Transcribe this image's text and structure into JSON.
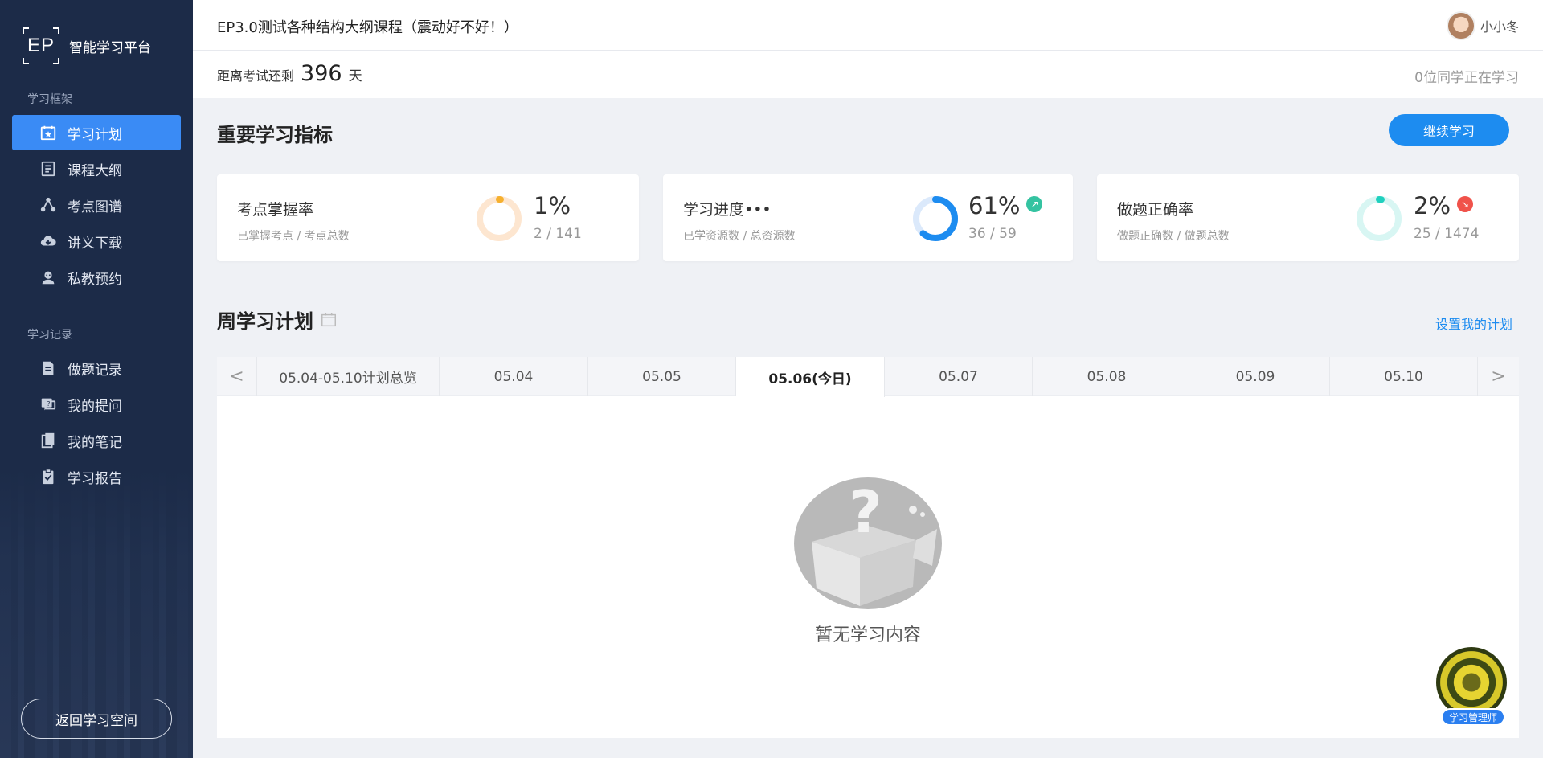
{
  "app": {
    "logo_text": "EP",
    "name": "智能学习平台"
  },
  "sidebar": {
    "section1": "学习框架",
    "items1": [
      {
        "label": "学习计划",
        "icon": "calendar-star-icon",
        "active": true
      },
      {
        "label": "课程大纲",
        "icon": "outline-icon"
      },
      {
        "label": "考点图谱",
        "icon": "graph-icon"
      },
      {
        "label": "讲义下载",
        "icon": "cloud-download-icon"
      },
      {
        "label": "私教预约",
        "icon": "tutor-icon"
      }
    ],
    "section2": "学习记录",
    "items2": [
      {
        "label": "做题记录",
        "icon": "document-icon"
      },
      {
        "label": "我的提问",
        "icon": "question-icon"
      },
      {
        "label": "我的笔记",
        "icon": "notes-icon"
      },
      {
        "label": "学习报告",
        "icon": "clipboard-icon"
      }
    ],
    "back_button": "返回学习空间"
  },
  "header": {
    "course_title": "EP3.0测试各种结构大纲课程（震动好不好！）",
    "username": "小小冬",
    "countdown_prefix": "距离考试还剩",
    "countdown_days": "396",
    "countdown_unit": "天",
    "studying_now": "0位同学正在学习"
  },
  "metrics": {
    "title": "重要学习指标",
    "continue_button": "继续学习",
    "cards": [
      {
        "label": "考点掌握率",
        "sub": "已掌握考点 / 考点总数",
        "pct": "1%",
        "ratio": "2 / 141",
        "value": 0.01,
        "color": "#f6b02e",
        "track": "#fde6d0"
      },
      {
        "label": "学习进度•••",
        "sub": "已学资源数 / 总资源数",
        "pct": "61%",
        "ratio": "36 / 59",
        "value": 0.61,
        "color": "#1d8cf0",
        "track": "#dbe9fb",
        "trend": "up",
        "trend_color": "#34c3a1"
      },
      {
        "label": "做题正确率",
        "sub": "做题正确数 / 做题总数",
        "pct": "2%",
        "ratio": "25 / 1474",
        "value": 0.02,
        "color": "#1fd0be",
        "track": "#d8f6f3",
        "trend": "down",
        "trend_color": "#f0524a"
      }
    ]
  },
  "weekly": {
    "title": "周学习计划",
    "set_plan_link": "设置我的计划",
    "tabs": [
      "05.04-05.10计划总览",
      "05.04",
      "05.05",
      "05.06(今日)",
      "05.07",
      "05.08",
      "05.09",
      "05.10"
    ],
    "today_index": 3,
    "prev": "<",
    "next": ">",
    "empty_text": "暂无学习内容"
  },
  "manager": {
    "label": "学习管理师"
  }
}
